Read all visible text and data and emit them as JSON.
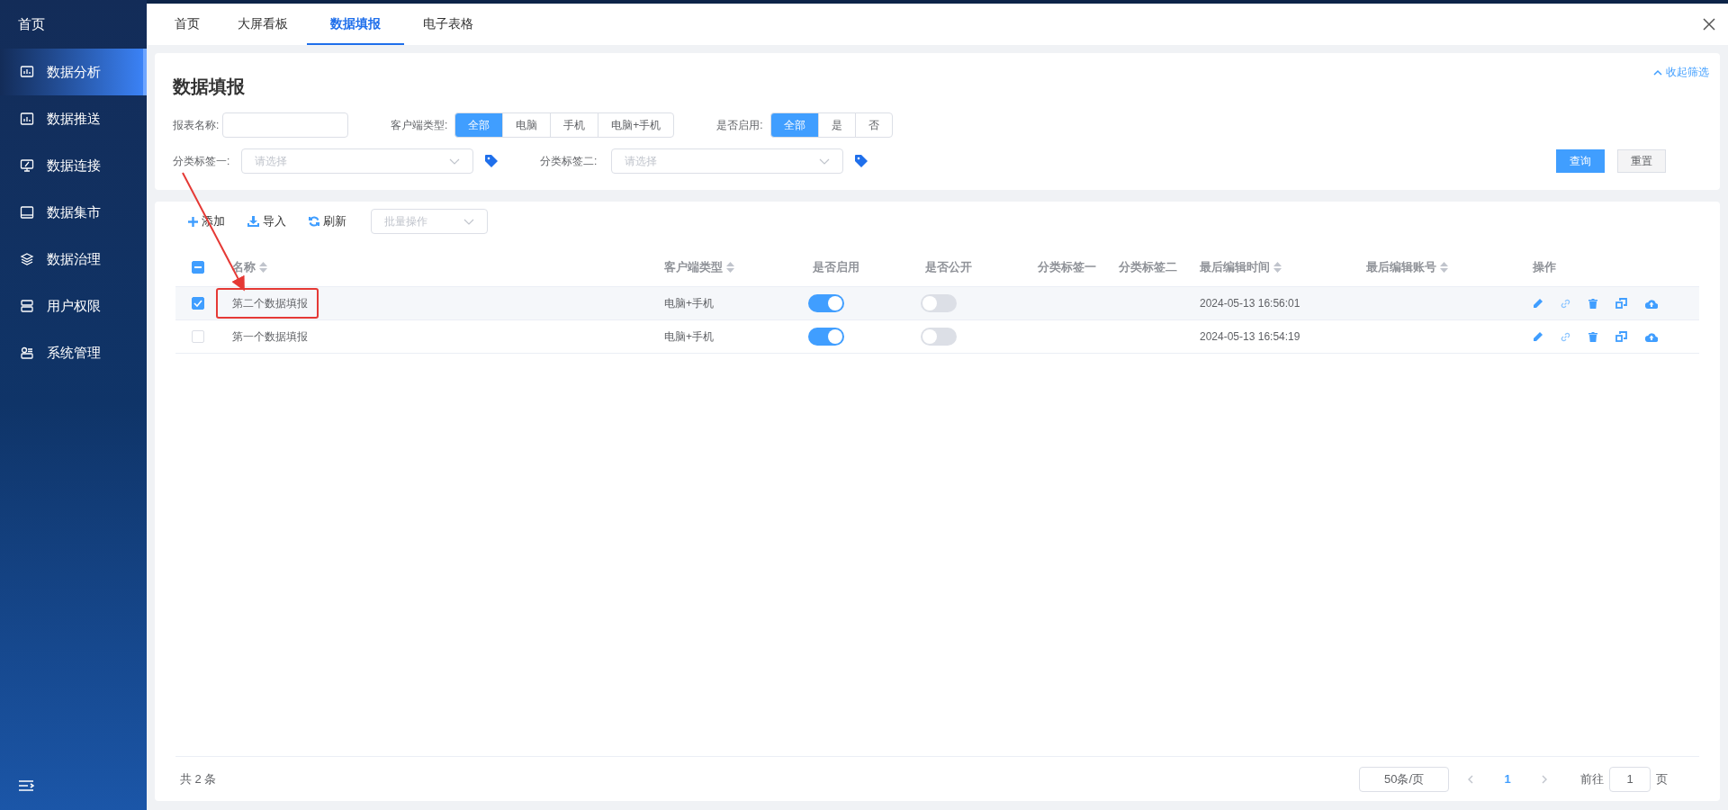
{
  "sidebar": {
    "home": "首页",
    "items": [
      {
        "label": "数据分析",
        "selected": true
      },
      {
        "label": "数据推送",
        "selected": false
      },
      {
        "label": "数据连接",
        "selected": false
      },
      {
        "label": "数据集市",
        "selected": false
      },
      {
        "label": "数据治理",
        "selected": false
      },
      {
        "label": "用户权限",
        "selected": false
      },
      {
        "label": "系统管理",
        "selected": false
      }
    ]
  },
  "tabs": [
    {
      "label": "首页",
      "selected": false
    },
    {
      "label": "大屏看板",
      "selected": false
    },
    {
      "label": "数据填报",
      "selected": true
    },
    {
      "label": "电子表格",
      "selected": false
    }
  ],
  "filter": {
    "title": "数据填报",
    "collapse_link": "收起筛选",
    "name_label": "报表名称:",
    "client_label": "客户端类型:",
    "client_options": [
      {
        "label": "全部",
        "selected": true
      },
      {
        "label": "电脑",
        "selected": false
      },
      {
        "label": "手机",
        "selected": false
      },
      {
        "label": "电脑+手机",
        "selected": false
      }
    ],
    "enabled_label": "是否启用:",
    "enabled_options": [
      {
        "label": "全部",
        "selected": true
      },
      {
        "label": "是",
        "selected": false
      },
      {
        "label": "否",
        "selected": false
      }
    ],
    "tag1_label": "分类标签一:",
    "tag1_placeholder": "请选择",
    "tag2_label": "分类标签二:",
    "tag2_placeholder": "请选择",
    "buttons": [
      {
        "label": "查询",
        "kind": "primary"
      },
      {
        "label": "重置",
        "kind": "default"
      }
    ]
  },
  "toolbar": {
    "buttons": [
      {
        "label": "添加",
        "kind": "add"
      },
      {
        "label": "导入",
        "kind": "import"
      },
      {
        "label": "刷新",
        "kind": "refresh"
      }
    ],
    "batch_placeholder": "批量操作"
  },
  "table": {
    "select_all_partial": true,
    "columns": [
      {
        "label": "名称",
        "sortable": true
      },
      {
        "label": "客户端类型",
        "sortable": true
      },
      {
        "label": "是否启用",
        "sortable": false
      },
      {
        "label": "是否公开",
        "sortable": false
      },
      {
        "label": "分类标签一",
        "sortable": false
      },
      {
        "label": "分类标签二",
        "sortable": false
      },
      {
        "label": "最后编辑时间",
        "sortable": true
      },
      {
        "label": "最后编辑账号",
        "sortable": true
      },
      {
        "label": "操作",
        "sortable": false
      }
    ],
    "rows": [
      {
        "checked": true,
        "highlighted": true,
        "name": "第二个数据填报",
        "client": "电脑+手机",
        "enabled": true,
        "public": false,
        "time": "2024-05-13 16:56:01"
      },
      {
        "checked": false,
        "highlighted": false,
        "name": "第一个数据填报",
        "client": "电脑+手机",
        "enabled": true,
        "public": false,
        "time": "2024-05-13 16:54:19"
      }
    ]
  },
  "footer": {
    "total": "共 2 条",
    "page_size": "50条/页",
    "pages": [
      {
        "label": "1",
        "selected": true
      }
    ],
    "goto_label": "前往",
    "goto_value": "1",
    "goto_suffix": "页"
  }
}
